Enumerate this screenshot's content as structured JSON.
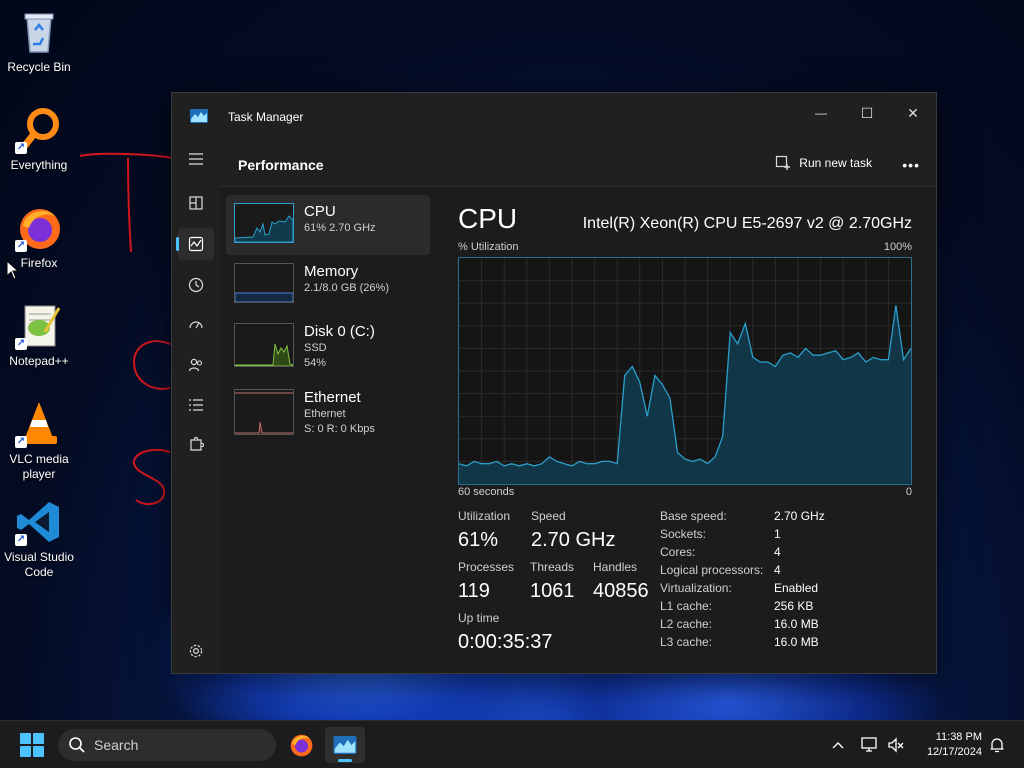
{
  "desktop": {
    "icons": [
      {
        "label": "Recycle Bin"
      },
      {
        "label": "Everything"
      },
      {
        "label": "Firefox"
      },
      {
        "label": "Notepad++"
      },
      {
        "label": "VLC media player"
      },
      {
        "label": "Visual Studio Code"
      }
    ]
  },
  "window": {
    "title": "Task Manager",
    "controls": {
      "minimize": "—",
      "maximize": "☐",
      "close": "✕"
    }
  },
  "header": {
    "page_title": "Performance",
    "run_new_task": "Run new task",
    "more": "•••"
  },
  "resources": [
    {
      "name": "CPU",
      "sub1": "61% 2.70 GHz",
      "sub2": "",
      "sub3": ""
    },
    {
      "name": "Memory",
      "sub1": "2.1/8.0 GB (26%)",
      "sub2": "",
      "sub3": ""
    },
    {
      "name": "Disk 0 (C:)",
      "sub1": "SSD",
      "sub2": "54%",
      "sub3": ""
    },
    {
      "name": "Ethernet",
      "sub1": "Ethernet",
      "sub2": "S: 0 R: 0 Kbps",
      "sub3": ""
    }
  ],
  "detail": {
    "title": "CPU",
    "model": "Intel(R) Xeon(R) CPU E5-2697 v2 @ 2.70GHz",
    "y_label": "% Utilization",
    "y_max_label": "100%",
    "x_left_label": "60 seconds",
    "x_right_label": "0"
  },
  "chart_data": {
    "type": "area",
    "title": "CPU",
    "xlabel": "60 seconds",
    "ylabel": "% Utilization",
    "ylim": [
      0,
      100
    ],
    "grid": true,
    "x_seconds_ago": [
      60,
      59,
      58,
      57,
      56,
      55,
      54,
      53,
      52,
      51,
      50,
      49,
      48,
      47,
      46,
      45,
      44,
      43,
      42,
      41,
      40,
      39,
      38,
      37,
      36,
      35,
      34,
      33,
      32,
      31,
      30,
      29,
      28,
      27,
      26,
      25,
      24,
      23,
      22,
      21,
      20,
      19,
      18,
      17,
      16,
      15,
      14,
      13,
      12,
      11,
      10,
      9,
      8,
      7,
      6,
      5,
      4,
      3,
      2,
      1,
      0
    ],
    "values": [
      9,
      8,
      10,
      9,
      9,
      10,
      8,
      9,
      8,
      9,
      8,
      9,
      12,
      10,
      9,
      8,
      10,
      9,
      9,
      10,
      10,
      9,
      48,
      52,
      45,
      30,
      48,
      44,
      38,
      14,
      11,
      10,
      11,
      9,
      12,
      21,
      67,
      62,
      71,
      56,
      54,
      54,
      52,
      57,
      58,
      56,
      60,
      57,
      57,
      58,
      59,
      55,
      56,
      58,
      54,
      56,
      55,
      55,
      79,
      55,
      60
    ]
  },
  "stats": {
    "utilization": {
      "label": "Utilization",
      "value": "61%"
    },
    "speed": {
      "label": "Speed",
      "value": "2.70 GHz"
    },
    "processes": {
      "label": "Processes",
      "value": "119"
    },
    "threads": {
      "label": "Threads",
      "value": "1061"
    },
    "handles": {
      "label": "Handles",
      "value": "40856"
    },
    "uptime": {
      "label": "Up time",
      "value": "0:00:35:37"
    }
  },
  "specs": [
    {
      "k": "Base speed:",
      "v": "2.70 GHz"
    },
    {
      "k": "Sockets:",
      "v": "1"
    },
    {
      "k": "Cores:",
      "v": "4"
    },
    {
      "k": "Logical processors:",
      "v": "4"
    },
    {
      "k": "Virtualization:",
      "v": "Enabled"
    },
    {
      "k": "L1 cache:",
      "v": "256 KB"
    },
    {
      "k": "L2 cache:",
      "v": "16.0 MB"
    },
    {
      "k": "L3 cache:",
      "v": "16.0 MB"
    }
  ],
  "taskbar": {
    "search_label": "Search",
    "time": "11:38 PM",
    "date": "12/17/2024"
  },
  "colors": {
    "accent": "#4cc2ff",
    "cpu_line": "#2a9fc9",
    "cpu_fill": "#0f3a4c",
    "memory_line": "#4a7fd8",
    "disk_line": "#7fbf3f",
    "ethernet_line": "#c06d6d",
    "annotation": "#d4161d"
  }
}
